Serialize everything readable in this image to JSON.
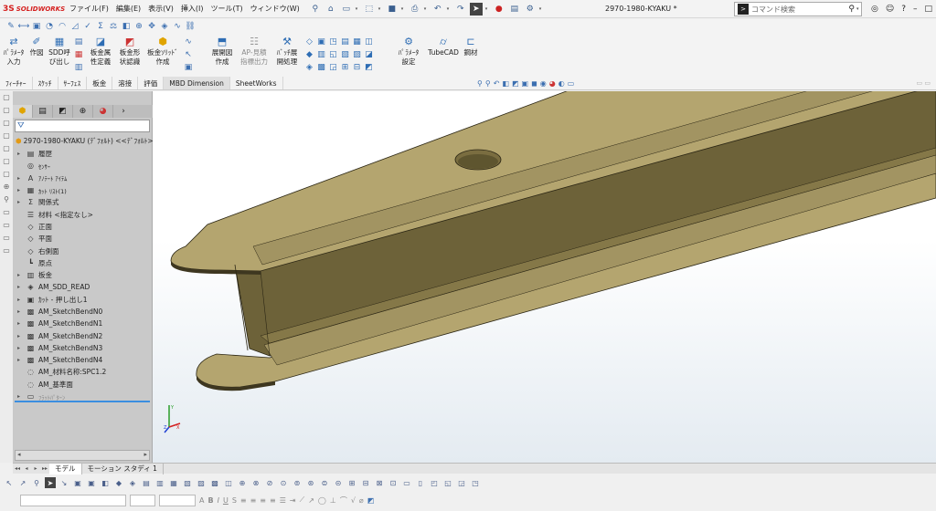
{
  "app": {
    "logo_mark": "3S",
    "logo_text": "SOLIDWORKS",
    "doc_title": "2970-1980-KYAKU *"
  },
  "menus": [
    "ファイル(F)",
    "編集(E)",
    "表示(V)",
    "挿入(I)",
    "ツール(T)",
    "ウィンドウ(W)"
  ],
  "search": {
    "placeholder": "コマンド検索"
  },
  "commands": [
    {
      "label": "ﾊﾟﾗﾒｰﾀ\n入力",
      "icon": "parameter-input-icon"
    },
    {
      "label": "作図",
      "icon": "drawing-icon"
    },
    {
      "label": "SDD呼\nび出し",
      "icon": "sdd-call-icon"
    },
    {
      "label": "板金属\n性定義",
      "icon": "sheetmetal-prop-icon"
    },
    {
      "label": "板金形\n状認識",
      "icon": "sheetmetal-recognize-icon"
    },
    {
      "label": "板金ｿﾘｯﾄﾞ\n作成",
      "icon": "sheetmetal-solid-icon"
    },
    {
      "label": "展開図\n作成",
      "icon": "flat-pattern-icon"
    },
    {
      "label": "AP-見積\n指標出力",
      "icon": "ap-estimate-icon"
    },
    {
      "label": "ﾊﾞｯﾁ展\n開処理",
      "icon": "batch-flatten-icon"
    },
    {
      "label": "ﾊﾟﾗﾒｰﾀ\n設定",
      "icon": "parameter-settings-icon"
    },
    {
      "label": "TubeCAD",
      "icon": "tubecad-icon"
    },
    {
      "label": "鋼材",
      "icon": "steel-icon"
    }
  ],
  "tabs": [
    "ﾌｨｰﾁｬｰ",
    "ｽｹｯﾁ",
    "ｻｰﾌｪｽ",
    "板金",
    "溶接",
    "評価",
    "MBD Dimension",
    "SheetWorks"
  ],
  "active_tab": "MBD Dimension",
  "feature_tree": {
    "root": "2970-1980-KYAKU (ﾃﾞﾌｫﾙﾄ) <<ﾃﾞﾌｫﾙﾄ>",
    "items": [
      {
        "label": "履歴",
        "icon": "history-icon",
        "arrow": "▸",
        "size": "n"
      },
      {
        "label": "ｾﾝｻｰ",
        "icon": "sensor-icon",
        "arrow": "",
        "size": "s"
      },
      {
        "label": "ｱﾉﾃｰﾄ ｱｲﾃﾑ",
        "icon": "annotations-icon",
        "arrow": "▸",
        "size": "s"
      },
      {
        "label": "ｶｯﾄ ﾘｽﾄ(1)",
        "icon": "cut-list-icon",
        "arrow": "▸",
        "size": "s"
      },
      {
        "label": "関係式",
        "icon": "equations-icon",
        "arrow": "▸",
        "size": "n"
      },
      {
        "label": "材料 <指定なし>",
        "icon": "material-icon",
        "arrow": "",
        "size": "n"
      },
      {
        "label": "正面",
        "icon": "plane-icon",
        "arrow": "",
        "size": "n"
      },
      {
        "label": "平面",
        "icon": "plane-icon",
        "arrow": "",
        "size": "n"
      },
      {
        "label": "右側面",
        "icon": "plane-icon",
        "arrow": "",
        "size": "n"
      },
      {
        "label": "原点",
        "icon": "origin-icon",
        "arrow": "",
        "size": "n"
      },
      {
        "label": "板金",
        "icon": "sheet-metal-icon",
        "arrow": "▸",
        "size": "n"
      },
      {
        "label": "AM_SDD_READ",
        "icon": "macro-feature-icon",
        "arrow": "▸",
        "size": "n"
      },
      {
        "label": "ｶｯﾄ - 押し出し1",
        "icon": "cut-extrude-icon",
        "arrow": "▸",
        "size": "n"
      },
      {
        "label": "AM_SketchBendN0",
        "icon": "sketch-bend-icon",
        "arrow": "▸",
        "size": "n"
      },
      {
        "label": "AM_SketchBendN1",
        "icon": "sketch-bend-icon",
        "arrow": "▸",
        "size": "n"
      },
      {
        "label": "AM_SketchBendN2",
        "icon": "sketch-bend-icon",
        "arrow": "▸",
        "size": "n"
      },
      {
        "label": "AM_SketchBendN3",
        "icon": "sketch-bend-icon",
        "arrow": "▸",
        "size": "n"
      },
      {
        "label": "AM_SketchBendN4",
        "icon": "sketch-bend-icon",
        "arrow": "▸",
        "size": "n"
      },
      {
        "label": "AM_材料名称:SPC1.2",
        "icon": "attribute-icon",
        "arrow": "",
        "size": "n"
      },
      {
        "label": "AM_基準面",
        "icon": "attribute-icon",
        "arrow": "",
        "size": "n"
      },
      {
        "label": "ﾌﾗｯﾄﾊﾟﾀｰﾝ",
        "icon": "flat-pattern-icon",
        "arrow": "▸",
        "size": "s",
        "faded": true
      }
    ]
  },
  "bottom_tabs": [
    "モデル",
    "モーション スタディ 1"
  ],
  "active_bottom_tab": "モデル",
  "colors": {
    "model_top": "#b4a56f",
    "model_side": "#6d6239",
    "model_edge": "#2b2614",
    "rollback": "#3b8ee0",
    "logo": "#d5201f"
  }
}
